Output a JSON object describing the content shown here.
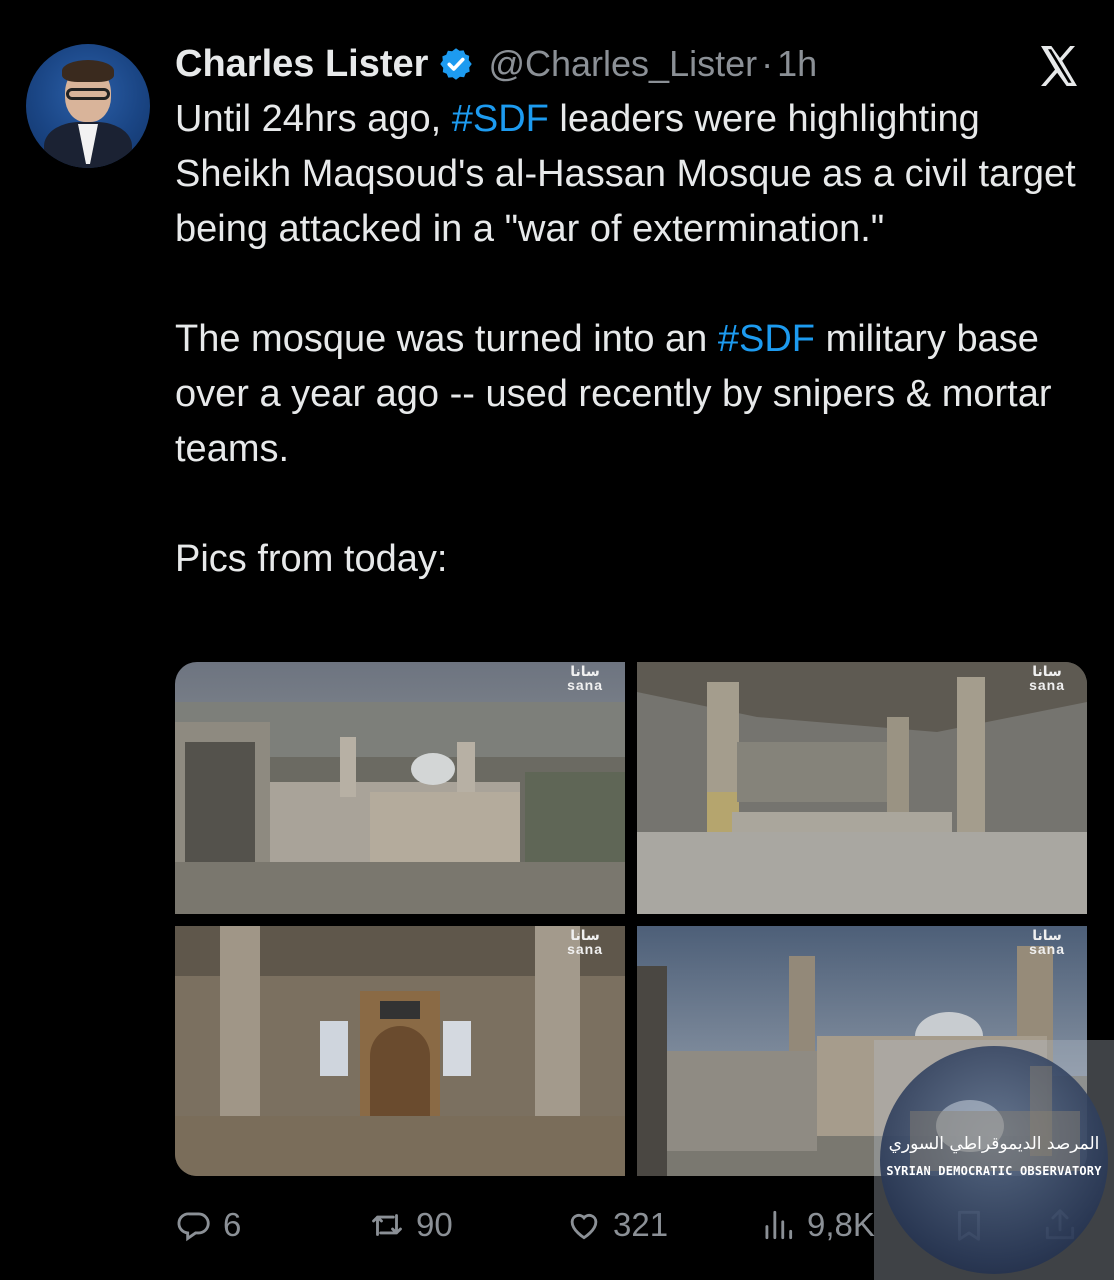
{
  "tweet": {
    "author_name": "Charles Lister",
    "author_handle": "@Charles_Lister",
    "separator": "·",
    "time": "1h",
    "segments": [
      {
        "text": "Until 24hrs ago, ",
        "type": "text"
      },
      {
        "text": "#SDF",
        "type": "hashtag"
      },
      {
        "text": " leaders were highlighting Sheikh Maqsoud's al-Hassan Mosque as a civil target being attacked in a \"war of extermination.\"\n\nThe mosque was turned into an ",
        "type": "text"
      },
      {
        "text": "#SDF",
        "type": "hashtag"
      },
      {
        "text": " military base over a year ago -- used recently by snipers & mortar teams.\n\nPics from today:",
        "type": "text"
      }
    ]
  },
  "media": {
    "watermark_arabic": "سانا",
    "watermark_latin": "sana"
  },
  "actions": {
    "replies": "6",
    "reposts": "90",
    "likes": "321",
    "views": "9,8K"
  },
  "overlay": {
    "arabic": "المرصد الديموقراطي السوري",
    "english": "SYRIAN DEMOCRATIC OBSERVATORY"
  },
  "colors": {
    "background": "#000000",
    "text": "#e7e9ea",
    "muted": "#8b9096",
    "hashtag": "#1d9bf0",
    "verified": "#1d9bf0"
  },
  "icons": [
    "verified-badge-icon",
    "x-logo-icon",
    "reply-icon",
    "repost-icon",
    "like-icon",
    "views-icon",
    "bookmark-icon",
    "share-icon"
  ]
}
